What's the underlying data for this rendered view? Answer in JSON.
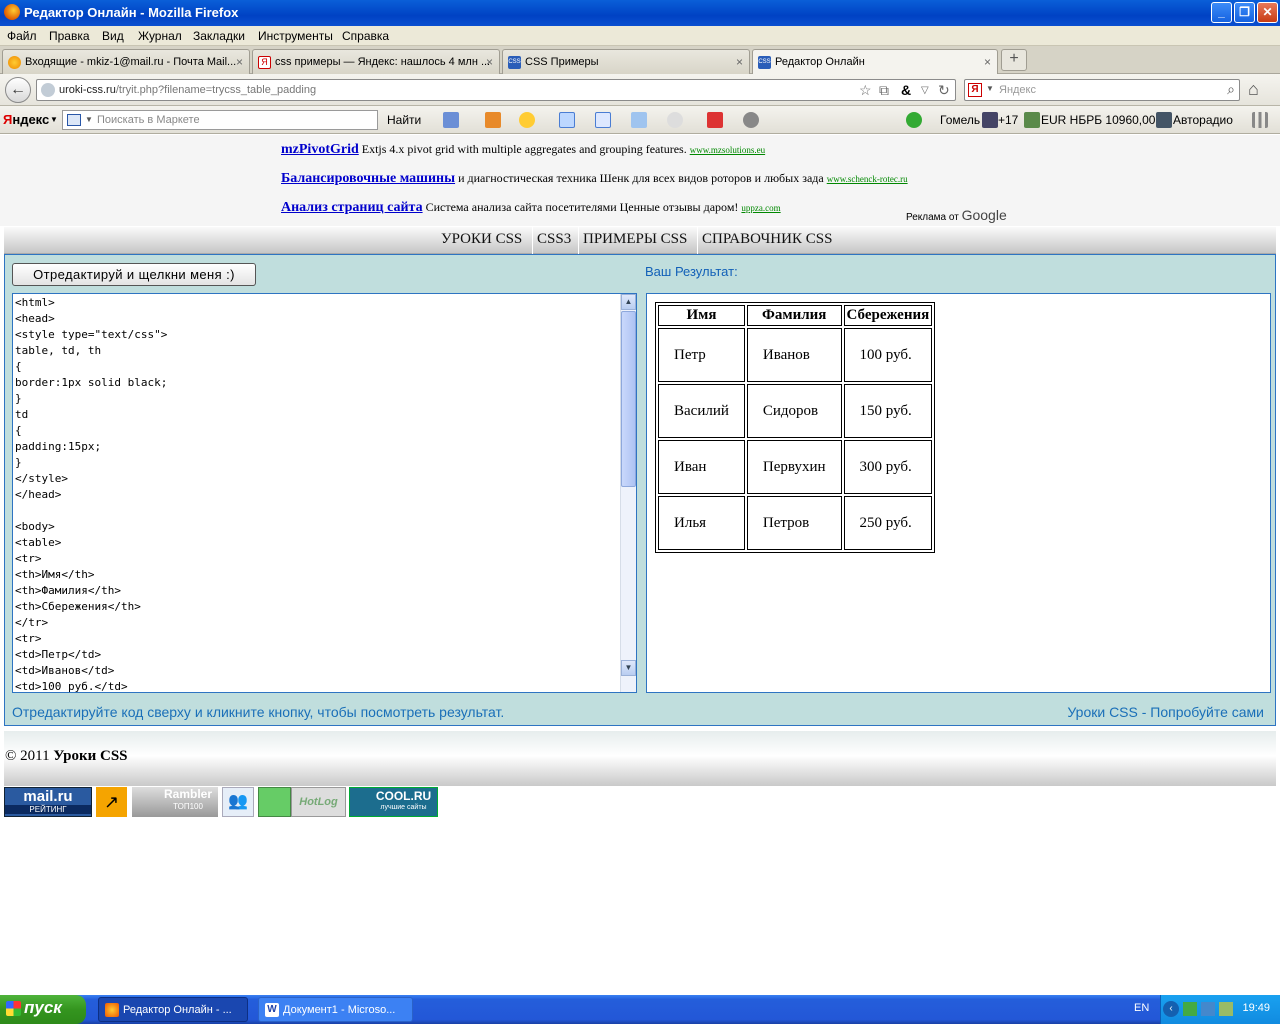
{
  "window": {
    "title": "Редактор Онлайн - Mozilla Firefox"
  },
  "menu": [
    "Файл",
    "Правка",
    "Вид",
    "Журнал",
    "Закладки",
    "Инструменты",
    "Справка"
  ],
  "tabs": [
    {
      "label": "Входящие - mkiz-1@mail.ru - Почта Mail...",
      "close": "×"
    },
    {
      "label": "css примеры — Яндекс: нашлось 4 млн ...",
      "close": "×"
    },
    {
      "label": "CSS Примеры",
      "close": "×"
    },
    {
      "label": "Редактор Онлайн",
      "close": "×"
    }
  ],
  "newtab": "+",
  "nav": {
    "url_host": "uroki-css.ru",
    "url_path": "/tryit.php?filename=trycss_table_padding",
    "search_placeholder": "Яндекс"
  },
  "yabar": {
    "logo_prefix": "Я",
    "logo_rest": "ндекс",
    "market_placeholder": "Поискать в Маркете",
    "find": "Найти",
    "weather_city": "Гомель",
    "weather_temp": "+17",
    "currency": "EUR НБРБ 10960,00",
    "radio": "Авторадио"
  },
  "ads": [
    {
      "title": "mzPivotGrid",
      "text": "Extjs 4.x pivot grid with multiple aggregates and grouping features.",
      "url": "www.mzsolutions.eu"
    },
    {
      "title": "Балансировочные машины",
      "text": "и диагностическая техника Шенк для всех видов роторов и любых зада",
      "url": "www.schenck-rotec.ru"
    },
    {
      "title": "Анализ страниц сайта",
      "text": "Система анализа сайта посетителями Ценные отзывы даром!",
      "url": "uppza.com"
    }
  ],
  "adgoogle": {
    "prefix": "Реклама от ",
    "brand": "Google"
  },
  "topnav": [
    "УРОКИ CSS",
    "CSS3",
    "ПРИМЕРЫ CSS",
    "СПРАВОЧНИК CSS"
  ],
  "editor": {
    "run_button": "Отредактируй и щелкни меня :)",
    "result_label": "Ваш Результат:",
    "code": "<html>\n<head>\n<style type=\"text/css\">\ntable, td, th\n{\nborder:1px solid black;\n}\ntd\n{\npadding:15px;\n}\n</style>\n</head>\n\n<body>\n<table>\n<tr>\n<th>Имя</th>\n<th>Фамилия</th>\n<th>Сбережения</th>\n</tr>\n<tr>\n<td>Петр</td>\n<td>Иванов</td>\n<td>100 руб.</td>",
    "hint": "Отредактируйте код сверху и кликните кнопку, чтобы посмотреть результат.",
    "link": "Уроки CSS - Попробуйте сами"
  },
  "result_table": {
    "headers": [
      "Имя",
      "Фамилия",
      "Сбережения"
    ],
    "rows": [
      [
        "Петр",
        "Иванов",
        "100 руб."
      ],
      [
        "Василий",
        "Сидоров",
        "150 руб."
      ],
      [
        "Иван",
        "Первухин",
        "300 руб."
      ],
      [
        "Илья",
        "Петров",
        "250 руб."
      ]
    ]
  },
  "footer": {
    "copyright": "© 2011 ",
    "site": "Уроки CSS"
  },
  "badges": {
    "mail_top": "mail.ru",
    "mail_bottom": "РЕЙТИНГ",
    "rambler_top": "Rambler",
    "rambler_bottom": "ТОП100",
    "hotlog": "HotLog",
    "cool_top": "COOL.RU",
    "cool_bottom": "лучшие сайты"
  },
  "taskbar": {
    "start": "пуск",
    "tasks": [
      "Редактор Онлайн - ...",
      "Документ1 - Microso..."
    ],
    "lang": "EN",
    "clock": "19:49"
  }
}
